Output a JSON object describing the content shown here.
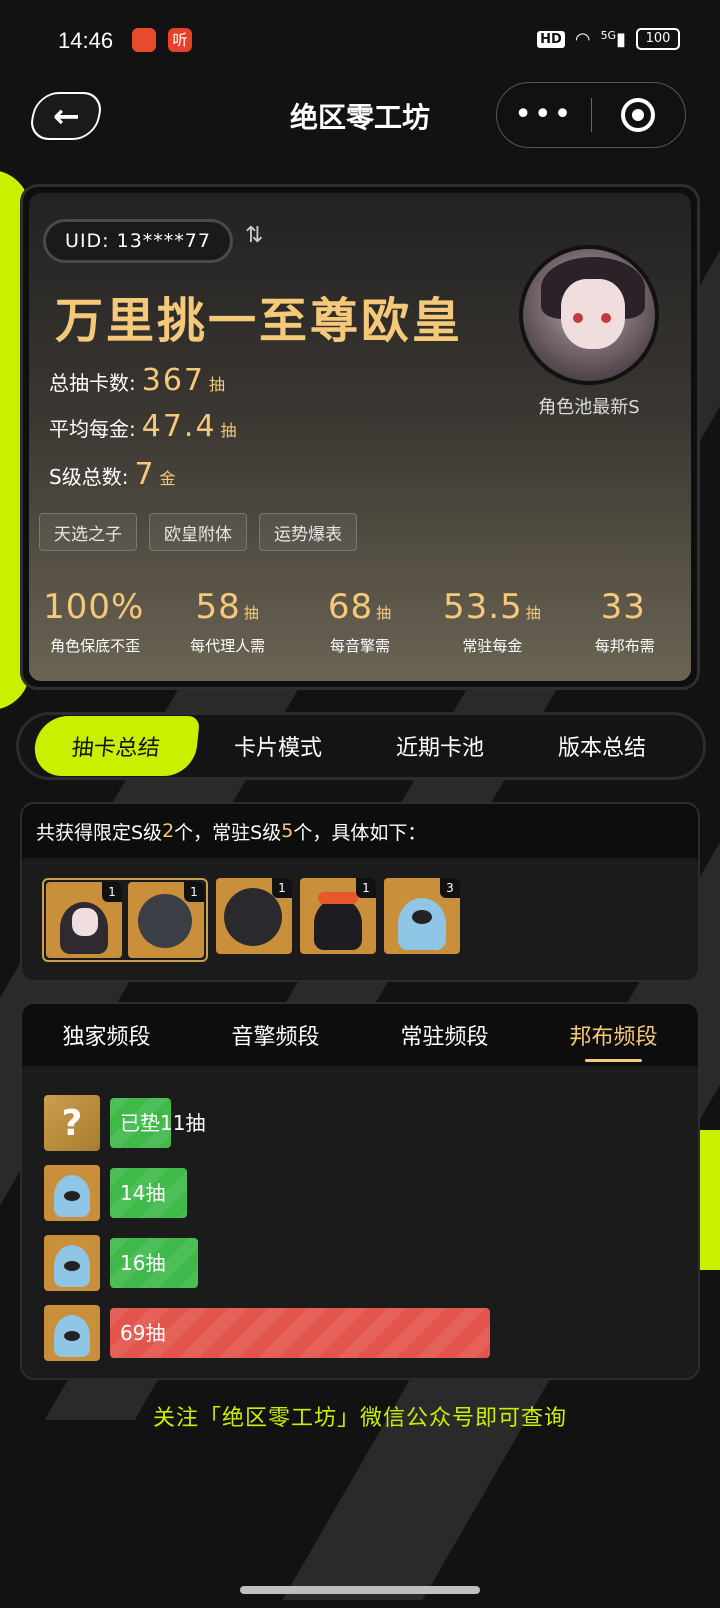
{
  "status_bar": {
    "time": "14:46",
    "app_icon_2_text": "听",
    "hd": "HD",
    "network": "5G",
    "battery": "100"
  },
  "header": {
    "title": "绝区零工坊",
    "back_icon": "back-arrow-icon",
    "more_icon": "more-dots-icon",
    "target_icon": "target-circle-icon"
  },
  "profile": {
    "uid": "UID: 13****77",
    "rank_title": "万里挑一至尊欧皇",
    "stats": [
      {
        "label": "总抽卡数:",
        "value": "367",
        "unit": "抽"
      },
      {
        "label": "平均每金:",
        "value": "47.4",
        "unit": "抽"
      },
      {
        "label": "S级总数:",
        "value": "7",
        "unit": "金"
      }
    ],
    "avatar_caption": "角色池最新S",
    "tags": [
      "天选之子",
      "欧皇附体",
      "运势爆表"
    ],
    "metrics": [
      {
        "value": "100%",
        "unit": "",
        "label": "角色保底不歪"
      },
      {
        "value": "58",
        "unit": "抽",
        "label": "每代理人需"
      },
      {
        "value": "68",
        "unit": "抽",
        "label": "每音擎需"
      },
      {
        "value": "53.5",
        "unit": "抽",
        "label": "常驻每金"
      },
      {
        "value": "33",
        "unit": "",
        "label": "每邦布需"
      }
    ]
  },
  "main_tabs": [
    "抽卡总结",
    "卡片模式",
    "近期卡池",
    "版本总结"
  ],
  "result": {
    "prefix": "共获得限定S级",
    "limited_count": "2",
    "mid": "个，常驻S级",
    "standard_count": "5",
    "suffix": "个，具体如下："
  },
  "result_icons": [
    {
      "name": "char-icon-girl",
      "count": "1"
    },
    {
      "name": "char-icon-shark-black",
      "count": "1"
    },
    {
      "name": "char-icon-ball",
      "count": "1"
    },
    {
      "name": "char-icon-girl2",
      "count": "1"
    },
    {
      "name": "char-icon-shark-blue",
      "count": "3"
    }
  ],
  "segment_tabs": [
    "独家频段",
    "音擎频段",
    "常驻频段",
    "邦布频段"
  ],
  "segment_rows": [
    {
      "label": "已垫11抽",
      "value": 11,
      "color": "green",
      "icon": "question-icon"
    },
    {
      "label": "14抽",
      "value": 14,
      "color": "green",
      "icon": "bangboo-shark-icon"
    },
    {
      "label": "16抽",
      "value": 16,
      "color": "green",
      "icon": "bangboo-shark-icon"
    },
    {
      "label": "69抽",
      "value": 69,
      "color": "red",
      "icon": "bangboo-shark-icon"
    }
  ],
  "footer_note": "关注「绝区零工坊」微信公众号即可查询"
}
